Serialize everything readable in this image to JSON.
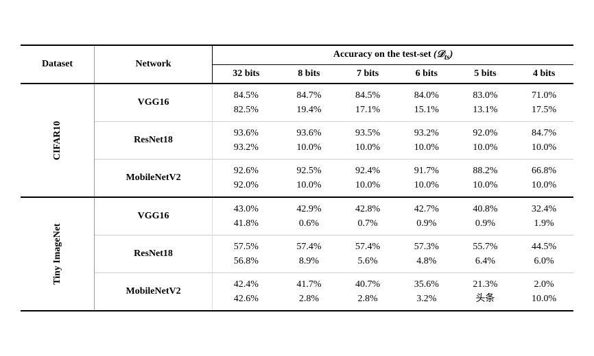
{
  "table": {
    "title": "Accuracy on the test-set",
    "title_math": "(D_ts)",
    "col_dataset": "Dataset",
    "col_network": "Network",
    "bit_cols": [
      "32 bits",
      "8 bits",
      "7 bits",
      "6 bits",
      "5 bits",
      "4 bits"
    ],
    "sections": [
      {
        "dataset": "CIFAR10",
        "rows": [
          {
            "network": "VGG16",
            "values": [
              [
                "84.5%",
                "82.5%"
              ],
              [
                "84.7%",
                "19.4%"
              ],
              [
                "84.5%",
                "17.1%"
              ],
              [
                "84.0%",
                "15.1%"
              ],
              [
                "83.0%",
                "13.1%"
              ],
              [
                "71.0%",
                "17.5%"
              ]
            ]
          },
          {
            "network": "ResNet18",
            "values": [
              [
                "93.6%",
                "93.2%"
              ],
              [
                "93.6%",
                "10.0%"
              ],
              [
                "93.5%",
                "10.0%"
              ],
              [
                "93.2%",
                "10.0%"
              ],
              [
                "92.0%",
                "10.0%"
              ],
              [
                "84.7%",
                "10.0%"
              ]
            ]
          },
          {
            "network": "MobileNetV2",
            "values": [
              [
                "92.6%",
                "92.0%"
              ],
              [
                "92.5%",
                "10.0%"
              ],
              [
                "92.4%",
                "10.0%"
              ],
              [
                "91.7%",
                "10.0%"
              ],
              [
                "88.2%",
                "10.0%"
              ],
              [
                "66.8%",
                "10.0%"
              ]
            ]
          }
        ]
      },
      {
        "dataset": "Tiny ImageNet",
        "rows": [
          {
            "network": "VGG16",
            "values": [
              [
                "43.0%",
                "41.8%"
              ],
              [
                "42.9%",
                "0.6%"
              ],
              [
                "42.8%",
                "0.7%"
              ],
              [
                "42.7%",
                "0.9%"
              ],
              [
                "40.8%",
                "0.9%"
              ],
              [
                "32.4%",
                "1.9%"
              ]
            ]
          },
          {
            "network": "ResNet18",
            "values": [
              [
                "57.5%",
                "56.8%"
              ],
              [
                "57.4%",
                "8.9%"
              ],
              [
                "57.4%",
                "5.6%"
              ],
              [
                "57.3%",
                "4.8%"
              ],
              [
                "55.7%",
                "6.4%"
              ],
              [
                "44.5%",
                "6.0%"
              ]
            ]
          },
          {
            "network": "MobileNetV2",
            "values": [
              [
                "42.4%",
                "42.6%"
              ],
              [
                "41.7%",
                "2.8%"
              ],
              [
                "40.7%",
                "2.8%"
              ],
              [
                "35.6%",
                "3.2%"
              ],
              [
                "21.3%",
                "头条"
              ],
              [
                "2.0%",
                "10.0%"
              ]
            ]
          }
        ]
      }
    ]
  }
}
